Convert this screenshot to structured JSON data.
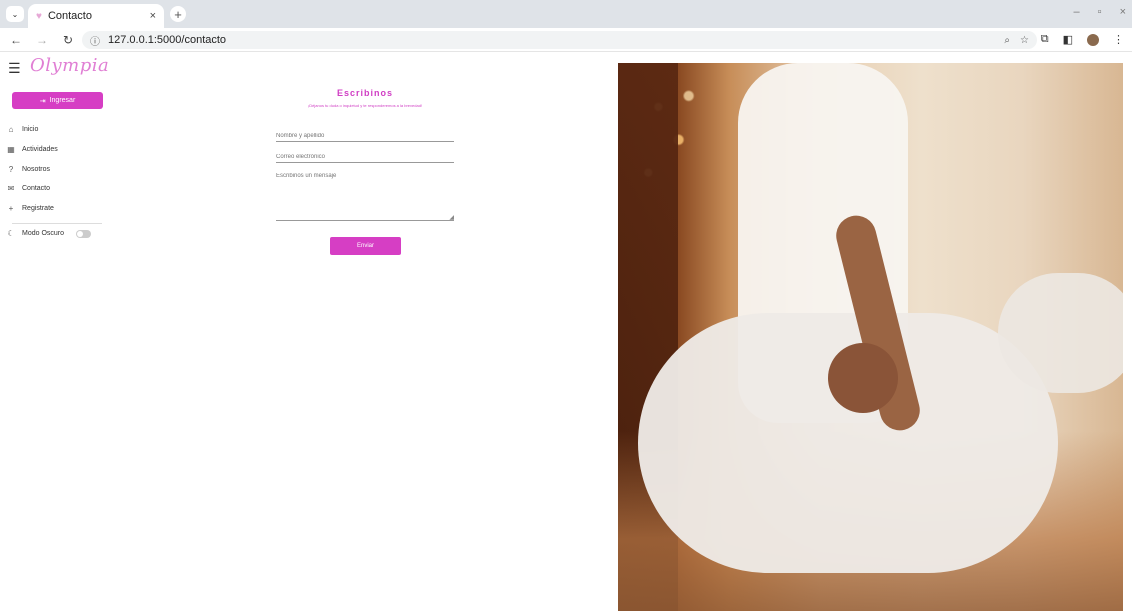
{
  "browser": {
    "tab_title": "Contacto",
    "tab_close": "×",
    "new_tab": "+",
    "url": "127.0.0.1:5000/contacto",
    "win_min": "–",
    "win_restore": "▫",
    "win_close": "×"
  },
  "sidebar": {
    "logo": "Olympia",
    "login_label": "Ingresar",
    "items": [
      {
        "label": "Inicio",
        "icon": "home-icon"
      },
      {
        "label": "Actividades",
        "icon": "activities-icon"
      },
      {
        "label": "Nosotros",
        "icon": "question-icon"
      },
      {
        "label": "Contacto",
        "icon": "mail-icon"
      },
      {
        "label": "Registrate",
        "icon": "plus-icon"
      }
    ],
    "dark_mode_label": "Modo Oscuro"
  },
  "form": {
    "title": "Escribinos",
    "subtitle": "¡Déjanos tu duda o inquietud y te responderemos a la brevedad!",
    "name_placeholder": "Nombre y apellido",
    "email_placeholder": "Correo electrónico",
    "message_placeholder": "Escribinos un mensaje",
    "send_label": "Enviar"
  },
  "colors": {
    "accent": "#d63ec4",
    "logo": "#e07fd4"
  }
}
